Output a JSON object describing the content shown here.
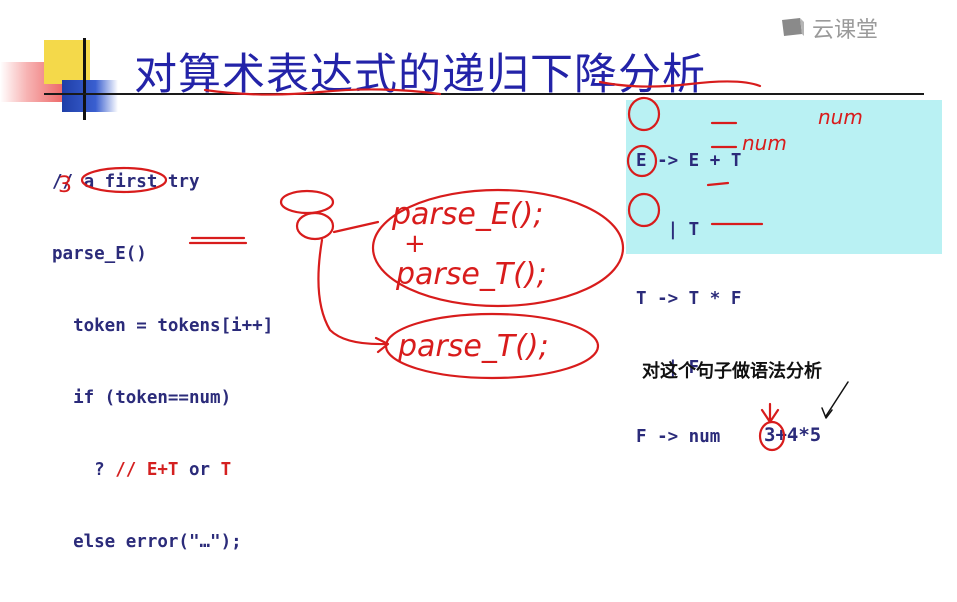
{
  "watermark": {
    "text": "云课堂",
    "icon": "cloud-classroom-logo-icon"
  },
  "slide": {
    "title": "对算术表达式的递归下降分析",
    "code_lines": [
      "// a first try",
      "parse_E()",
      "  token = tokens[i++]",
      "  if (token==num)",
      "    ? ",
      "  else error(\"…\");"
    ],
    "code_ternary_tail": {
      "comment": "//",
      "first": "E+T",
      "or": "or",
      "second": "T"
    },
    "grammar": [
      "E -> E + T",
      "   | T",
      "T -> T * F",
      "   | F",
      "F -> num"
    ],
    "question": "对这个句子做语法分析",
    "sentence": "3+4*5"
  },
  "annotations": {
    "token_prefix": "3",
    "num_1": "num",
    "num_2": "num",
    "call_1": "parse_E();",
    "plus": "+",
    "call_2": "parse_T();",
    "call_3": "parse_T();",
    "ink_color": "#d81c1c"
  },
  "colors": {
    "title": "#2323a8",
    "code": "#2b2b7a",
    "grammar_bg": "#b9f1f3",
    "accent_yellow": "#f4d94a"
  }
}
